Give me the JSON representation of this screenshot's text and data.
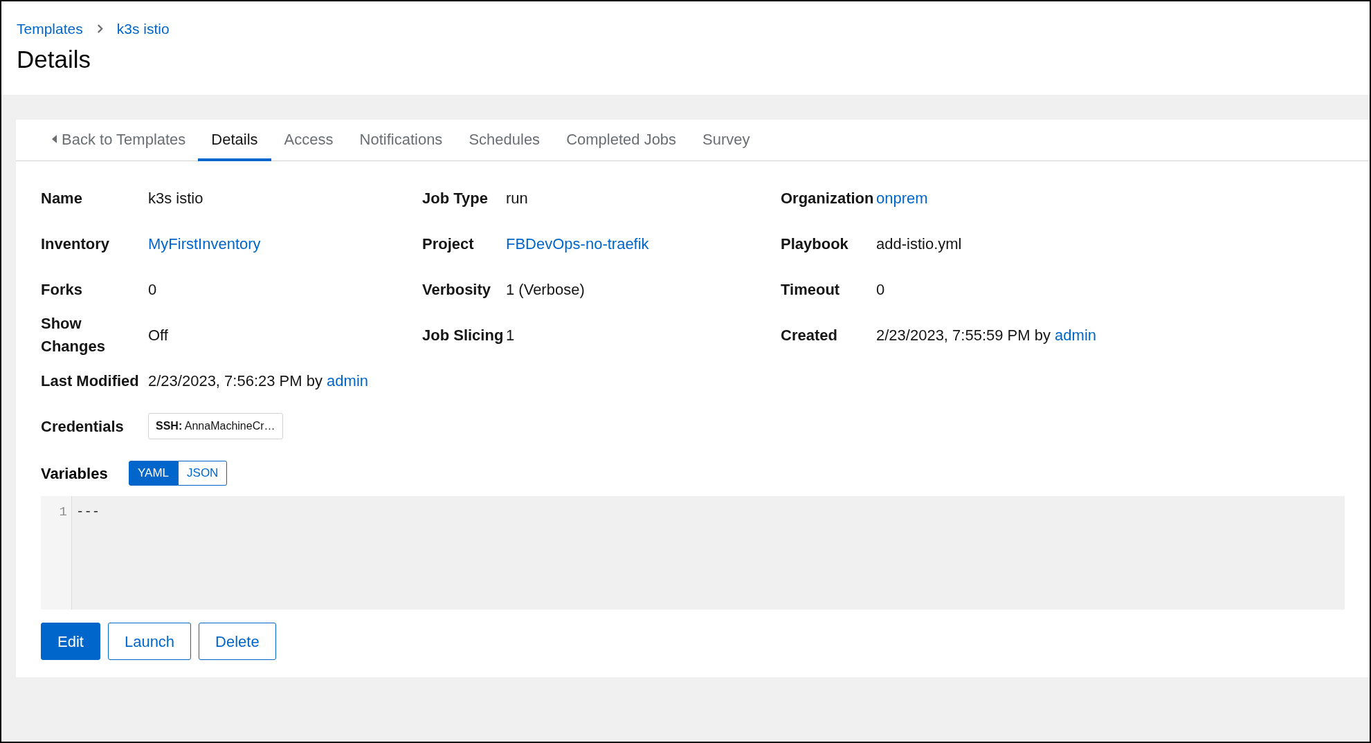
{
  "breadcrumb": [
    {
      "label": "Templates"
    },
    {
      "label": "k3s istio"
    }
  ],
  "title": "Details",
  "tabs": [
    {
      "label": "Back to Templates",
      "kind": "back",
      "selected": false
    },
    {
      "label": "Details",
      "kind": "tab",
      "selected": true
    },
    {
      "label": "Access",
      "kind": "tab",
      "selected": false
    },
    {
      "label": "Notifications",
      "kind": "tab",
      "selected": false
    },
    {
      "label": "Schedules",
      "kind": "tab",
      "selected": false
    },
    {
      "label": "Completed Jobs",
      "kind": "tab",
      "selected": false
    },
    {
      "label": "Survey",
      "kind": "tab",
      "selected": false
    }
  ],
  "detail_rows": [
    [
      {
        "label": "Name",
        "kind": "text",
        "value": "k3s istio"
      },
      {
        "label": "Job Type",
        "kind": "text",
        "value": "run"
      },
      {
        "label": "Organization",
        "kind": "link",
        "value": "onprem"
      }
    ],
    [
      {
        "label": "Inventory",
        "kind": "link",
        "value": "MyFirstInventory"
      },
      {
        "label": "Project",
        "kind": "link",
        "value": "FBDevOps-no-traefik"
      },
      {
        "label": "Playbook",
        "kind": "text",
        "value": "add-istio.yml"
      }
    ],
    [
      {
        "label": "Forks",
        "kind": "text",
        "value": "0"
      },
      {
        "label": "Verbosity",
        "kind": "text",
        "value": "1 (Verbose)"
      },
      {
        "label": "Timeout",
        "kind": "text",
        "value": "0"
      }
    ],
    [
      {
        "label": "Show Changes",
        "kind": "text",
        "value": "Off"
      },
      {
        "label": "Job Slicing",
        "kind": "text",
        "value": "1"
      },
      {
        "label": "Created",
        "kind": "by",
        "value": "2/23/2023, 7:55:59 PM by",
        "link": "admin"
      }
    ],
    [
      {
        "label": "Last Modified",
        "kind": "by",
        "value": "2/23/2023, 7:56:23 PM by",
        "link": "admin"
      }
    ],
    [
      {
        "label": "Credentials",
        "kind": "chip",
        "value": "**SSH:** AnnaMachineCr…"
      }
    ]
  ],
  "variables": {
    "label": "Variables",
    "modes": [
      {
        "label": "YAML",
        "selected": true
      },
      {
        "label": "JSON",
        "selected": false
      }
    ],
    "lines": [
      {
        "number": "1",
        "text": "---"
      }
    ]
  },
  "buttons": [
    {
      "label": "Edit",
      "kind": "primary"
    },
    {
      "label": "Launch",
      "kind": "secondary"
    },
    {
      "label": "Delete",
      "kind": "secondary"
    }
  ]
}
